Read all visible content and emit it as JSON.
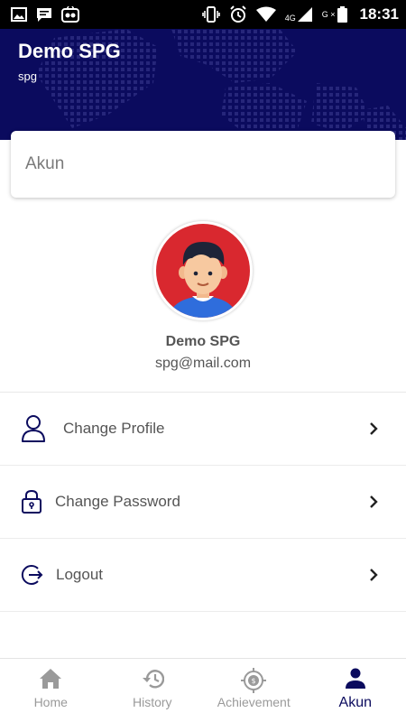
{
  "status_bar": {
    "time": "18:31",
    "network": "4G",
    "extra": "G ×"
  },
  "header": {
    "title": "Demo SPG",
    "subtitle": "spg"
  },
  "page": {
    "title": "Akun"
  },
  "profile": {
    "name": "Demo SPG",
    "email": "spg@mail.com"
  },
  "menu": [
    {
      "label": "Change Profile",
      "icon": "user-icon"
    },
    {
      "label": "Change Password",
      "icon": "lock-icon"
    },
    {
      "label": "Logout",
      "icon": "logout-icon"
    }
  ],
  "bottom_nav": [
    {
      "label": "Home",
      "icon": "home-icon",
      "active": false
    },
    {
      "label": "History",
      "icon": "history-icon",
      "active": false
    },
    {
      "label": "Achievement",
      "icon": "achievement-icon",
      "active": false
    },
    {
      "label": "Akun",
      "icon": "person-icon",
      "active": true
    }
  ],
  "colors": {
    "primary": "#0b0b5e",
    "avatar_bg": "#d9282f",
    "avatar_shirt": "#2f6ddc"
  }
}
